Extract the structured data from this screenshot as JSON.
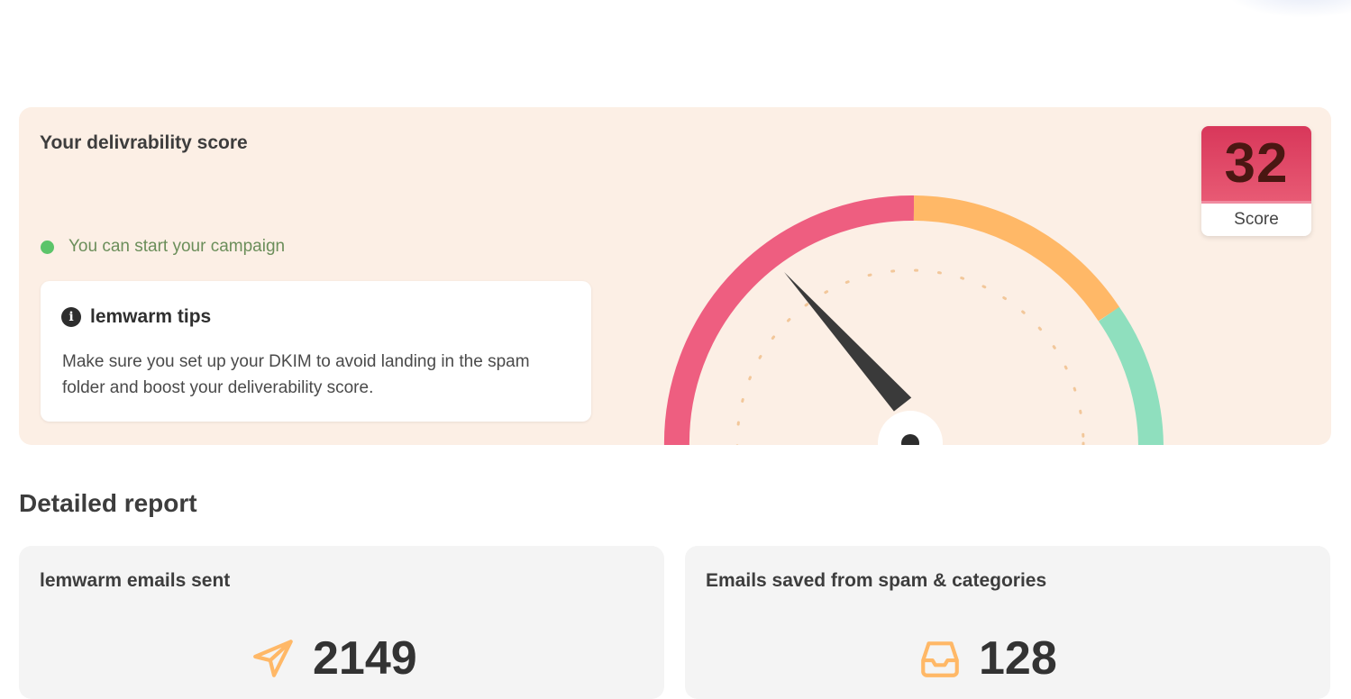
{
  "score_section": {
    "title": "Your delivrability score",
    "status_text": "You can start your campaign",
    "tips": {
      "title": "lemwarm tips",
      "body": "Make sure you set up your DKIM to avoid landing in the spam folder and boost your deliverability score."
    },
    "score_value": "32",
    "score_label": "Score",
    "colors": {
      "low": "#ee5e80",
      "medium": "#ffb867",
      "high": "#8fdfbe",
      "status_dot": "#5cc46a"
    }
  },
  "report": {
    "title": "Detailed report",
    "cards": [
      {
        "title": "lemwarm emails sent",
        "value": "2149",
        "icon": "paper-plane-icon"
      },
      {
        "title": "Emails saved from spam & categories",
        "value": "128",
        "icon": "inbox-tray-icon"
      }
    ]
  }
}
